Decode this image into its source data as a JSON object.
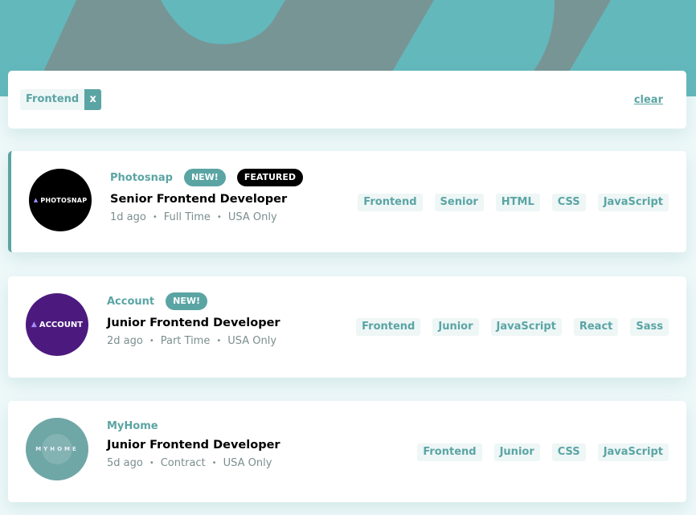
{
  "filter": {
    "chips": [
      {
        "label": "Frontend",
        "remove": "x"
      }
    ],
    "clear_label": "clear"
  },
  "jobs": [
    {
      "company": "Photosnap",
      "logo_text": "PHOTOSNAP",
      "new_badge": "NEW!",
      "featured_badge": "FEATURED",
      "position": "Senior Frontend Developer",
      "posted": "1d ago",
      "contract": "Full Time",
      "location": "USA Only",
      "tags": [
        "Frontend",
        "Senior",
        "HTML",
        "CSS",
        "JavaScript"
      ]
    },
    {
      "company": "Account",
      "logo_text": "ACCOUNT",
      "new_badge": "NEW!",
      "position": "Junior Frontend Developer",
      "posted": "2d ago",
      "contract": "Part Time",
      "location": "USA Only",
      "tags": [
        "Frontend",
        "Junior",
        "JavaScript",
        "React",
        "Sass"
      ]
    },
    {
      "company": "MyHome",
      "logo_text": "MYHOME",
      "position": "Junior Frontend Developer",
      "posted": "5d ago",
      "contract": "Contract",
      "location": "USA Only",
      "tags": [
        "Frontend",
        "Junior",
        "CSS",
        "JavaScript"
      ]
    }
  ],
  "meta_separator": "•",
  "colors": {
    "primary": "#5ba4a4",
    "header_bg": "#63b8bc",
    "tag_bg": "#eef6f6",
    "page_bg": "#eef8f9"
  }
}
